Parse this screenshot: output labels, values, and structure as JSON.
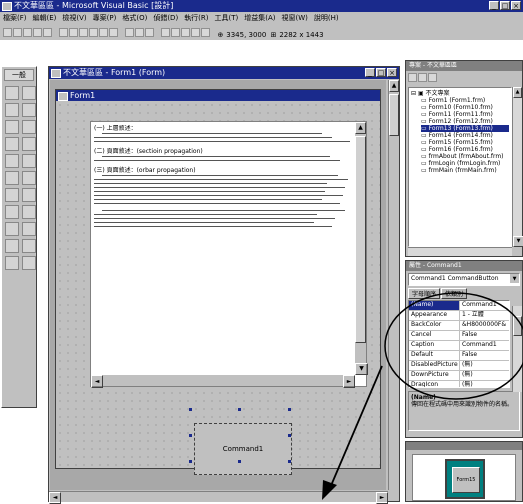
{
  "app": {
    "title": "不文華區區 - Microsoft Visual Basic [設計]",
    "menu": [
      "檔案(F)",
      "編輯(E)",
      "檢視(V)",
      "專案(P)",
      "格式(O)",
      "偵錯(D)",
      "執行(R)",
      "工具(T)",
      "增益集(A)",
      "視窗(W)",
      "說明(H)"
    ],
    "position_readout": "3345, 3000 ",
    "size_readout": "2282 x 1443"
  },
  "toolbox": {
    "title": "一般"
  },
  "designer": {
    "title": "不文華區區 - Form1 (Form)",
    "form_title": "Form1",
    "command_label": "Command1"
  },
  "document": {
    "sections": [
      {
        "heading": "(一) 上層敘述：",
        "lines": 3
      },
      {
        "heading": "(二) 頁面敘述：(sectioin propagation)",
        "lines": 2
      },
      {
        "heading": "(三) 頁面敘述：(orbar propagation)",
        "lines": 8
      },
      {
        "heading": "",
        "lines": 5
      }
    ]
  },
  "project": {
    "title": "專案 - 不文華區區",
    "root": "不文專案",
    "items": [
      "Form1 (Form1.frm)",
      "Form10 (Form10.frm)",
      "Form11 (Form11.frm)",
      "Form12 (Form12.frm)",
      "Form13 (Form13.frm)",
      "Form14 (Form14.frm)",
      "Form15 (Form15.frm)",
      "Form16 (Form16.frm)",
      "frmAbout (frmAbout.frm)",
      "frmLogin (frmLogin.frm)",
      "frmMain (frmMain.frm)"
    ],
    "selected_index": 4
  },
  "properties": {
    "title": "屬性 - Command1",
    "object": "Command1 CommandButton",
    "tabs": [
      "字母順序",
      "依類別"
    ],
    "rows": [
      {
        "k": "(Name)",
        "v": "Command1",
        "selected": true
      },
      {
        "k": "Appearance",
        "v": "1 - 立體"
      },
      {
        "k": "BackColor",
        "v": "&H8000000F&"
      },
      {
        "k": "Cancel",
        "v": "False"
      },
      {
        "k": "Caption",
        "v": "Command1"
      },
      {
        "k": "Default",
        "v": "False"
      },
      {
        "k": "DisabledPicture",
        "v": "(無)"
      },
      {
        "k": "DownPicture",
        "v": "(無)"
      },
      {
        "k": "DragIcon",
        "v": "(無)"
      }
    ],
    "desc_title": "(Name)",
    "desc_text": "傳回在程式碼中用來識別物件的名稱。"
  },
  "layout_window": {
    "form_label": "Form15"
  },
  "colors": {
    "titlebar": "#1a2a8c",
    "face": "#c0c0c0",
    "selected": "#1a2a8c"
  }
}
